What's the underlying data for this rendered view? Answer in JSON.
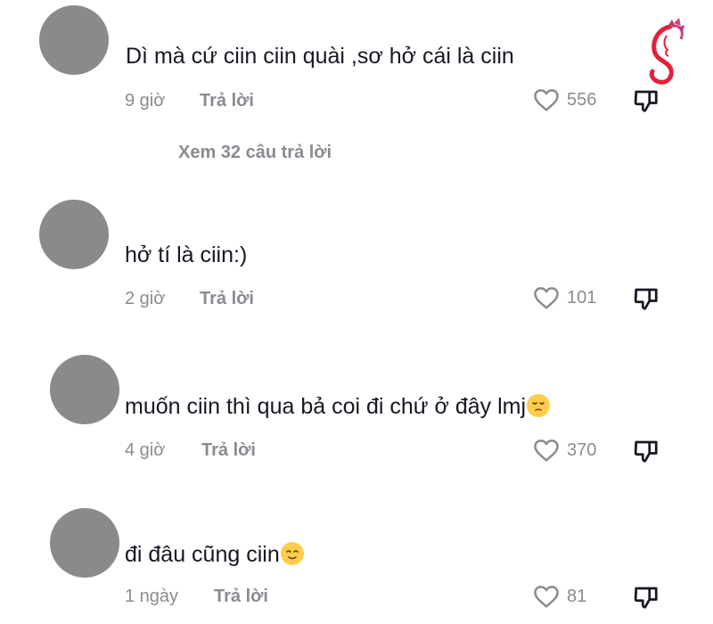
{
  "comments": [
    {
      "text": "Dì mà cứ ciin ciin quài ,sơ hở cái là ciin",
      "time": "9 giờ",
      "reply_label": "Trả lời",
      "likes": "556"
    },
    {
      "text": "hở tí là ciin:)",
      "time": "2 giờ",
      "reply_label": "Trả lời",
      "likes": "101"
    },
    {
      "text": "muốn ciin thì qua bả coi đi chứ ở đây lmj",
      "time": "4 giờ",
      "reply_label": "Trả lời",
      "likes": "370"
    },
    {
      "text": "đi đâu cũng ciin",
      "time": "1 ngày",
      "reply_label": "Trả lời",
      "likes": "81"
    }
  ],
  "view_replies": "Xem 32 câu trả lời",
  "icons": {
    "like": "heart-outline-icon",
    "dislike": "thumbs-down-icon",
    "emoji_3": "pensive-face-emoji",
    "emoji_4": "relieved-face-emoji",
    "logo": "woman-silhouette-logo"
  },
  "colors": {
    "text": "#161823",
    "secondary": "#8a8b91",
    "avatar": "#8a8a8a",
    "logo_red": "#e5203a",
    "logo_pink": "#d0457a"
  }
}
